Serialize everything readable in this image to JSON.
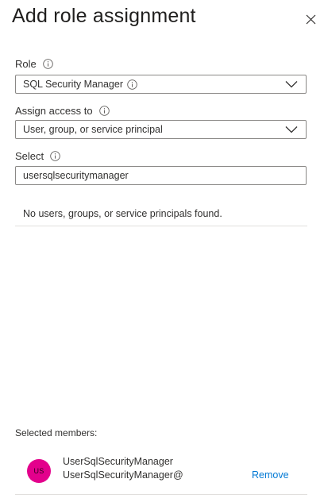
{
  "header": {
    "title": "Add role assignment"
  },
  "role": {
    "label": "Role",
    "selected": "SQL Security Manager"
  },
  "assign_access": {
    "label": "Assign access to",
    "selected": "User, group, or service principal"
  },
  "select": {
    "label": "Select",
    "value": "usersqlsecuritymanager",
    "empty_message": "No users, groups, or service principals found."
  },
  "selected_members": {
    "label": "Selected members:",
    "items": [
      {
        "initials": "US",
        "name": "UserSqlSecurityManager",
        "upn": "UserSqlSecurityManager@",
        "remove_label": "Remove",
        "avatar_color": "#e3008c"
      }
    ]
  },
  "colors": {
    "link": "#0078d4",
    "border": "#8a8886",
    "divider": "#e1dfdd"
  },
  "icons": {
    "close": "close-icon",
    "info": "info-icon",
    "dropdown": "chevron-down-icon"
  }
}
